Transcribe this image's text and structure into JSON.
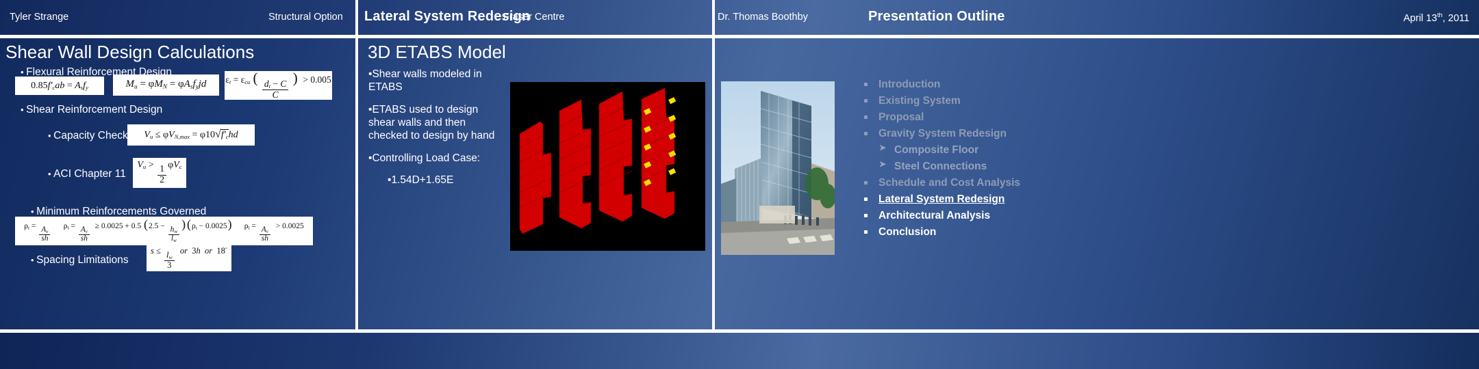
{
  "header": {
    "mid_title": "Lateral System Redesign",
    "right_title": "Presentation Outline"
  },
  "left_panel": {
    "heading": "Shear Wall Design Calculations",
    "bullets": {
      "flexural": "Flexural Reinforcement Design",
      "shear": "Shear Reinforcement Design",
      "capacity": "Capacity Check",
      "aci": "ACI Chapter 11",
      "minimum": "Minimum Reinforcements Governed",
      "spacing": "Spacing Limitations"
    },
    "formulas": {
      "f1_plain": "0.85 f'c ab = As fy",
      "f2_plain": "Mu = φMN = φ As fy jd",
      "f3_plain": "εt = εcu ((dt − c)/c) > 0.005",
      "f4_plain": "Vu ≤ φVN,max = φ10√f'c hd",
      "f5_plain": "Vu > (1/2) φVc",
      "f6_plain": "ρt = Av/sh     ρl = Av/sh ≥ 0.0025 + 0.5 (2.5 − hw/lw)(ρt − 0.0025)     ρl = Av/sh > 0.0025",
      "f7_plain": "s ≤ lw/3  or  3h  or  18\""
    }
  },
  "mid_panel": {
    "heading": "3D ETABS Model",
    "bullets": [
      "Shear walls modeled in ETABS",
      "ETABS used to design shear walls and then checked to design by hand",
      "Controlling Load Case:"
    ],
    "load_case": "1.54D+1.65E",
    "image_label": "etabs-3d-shear-wall-model"
  },
  "right_panel": {
    "photo_label": "building-exterior-rendering",
    "outline": [
      {
        "label": "Introduction",
        "level": 1,
        "state": "dim"
      },
      {
        "label": "Existing System",
        "level": 1,
        "state": "dim"
      },
      {
        "label": "Proposal",
        "level": 1,
        "state": "dim"
      },
      {
        "label": "Gravity System Redesign",
        "level": 1,
        "state": "dim"
      },
      {
        "label": "Composite Floor",
        "level": 2,
        "state": "dim"
      },
      {
        "label": "Steel Connections",
        "level": 2,
        "state": "dim"
      },
      {
        "label": "Schedule and Cost Analysis",
        "level": 1,
        "state": "dim"
      },
      {
        "label": "Lateral System Redesign",
        "level": 1,
        "state": "active"
      },
      {
        "label": "Architectural Analysis",
        "level": 1,
        "state": "bright"
      },
      {
        "label": "Conclusion",
        "level": 1,
        "state": "bright"
      }
    ]
  },
  "footer": {
    "presenter": "Tyler Strange",
    "option": "Structural Option",
    "project": "Fraser Centre",
    "advisor": "Dr. Thomas Boothby",
    "date_main": "April 13",
    "date_suffix": "th",
    "date_year": ", 2011"
  },
  "colors": {
    "background_dark": "#12295c",
    "background_light": "#4a6aa1",
    "rule": "#ffffff",
    "text": "#ffffff",
    "dim_text": "#8f9cb5",
    "formula_box": "#ffffff",
    "wall_red": "#d40000",
    "link_yellow": "#f5e400"
  }
}
